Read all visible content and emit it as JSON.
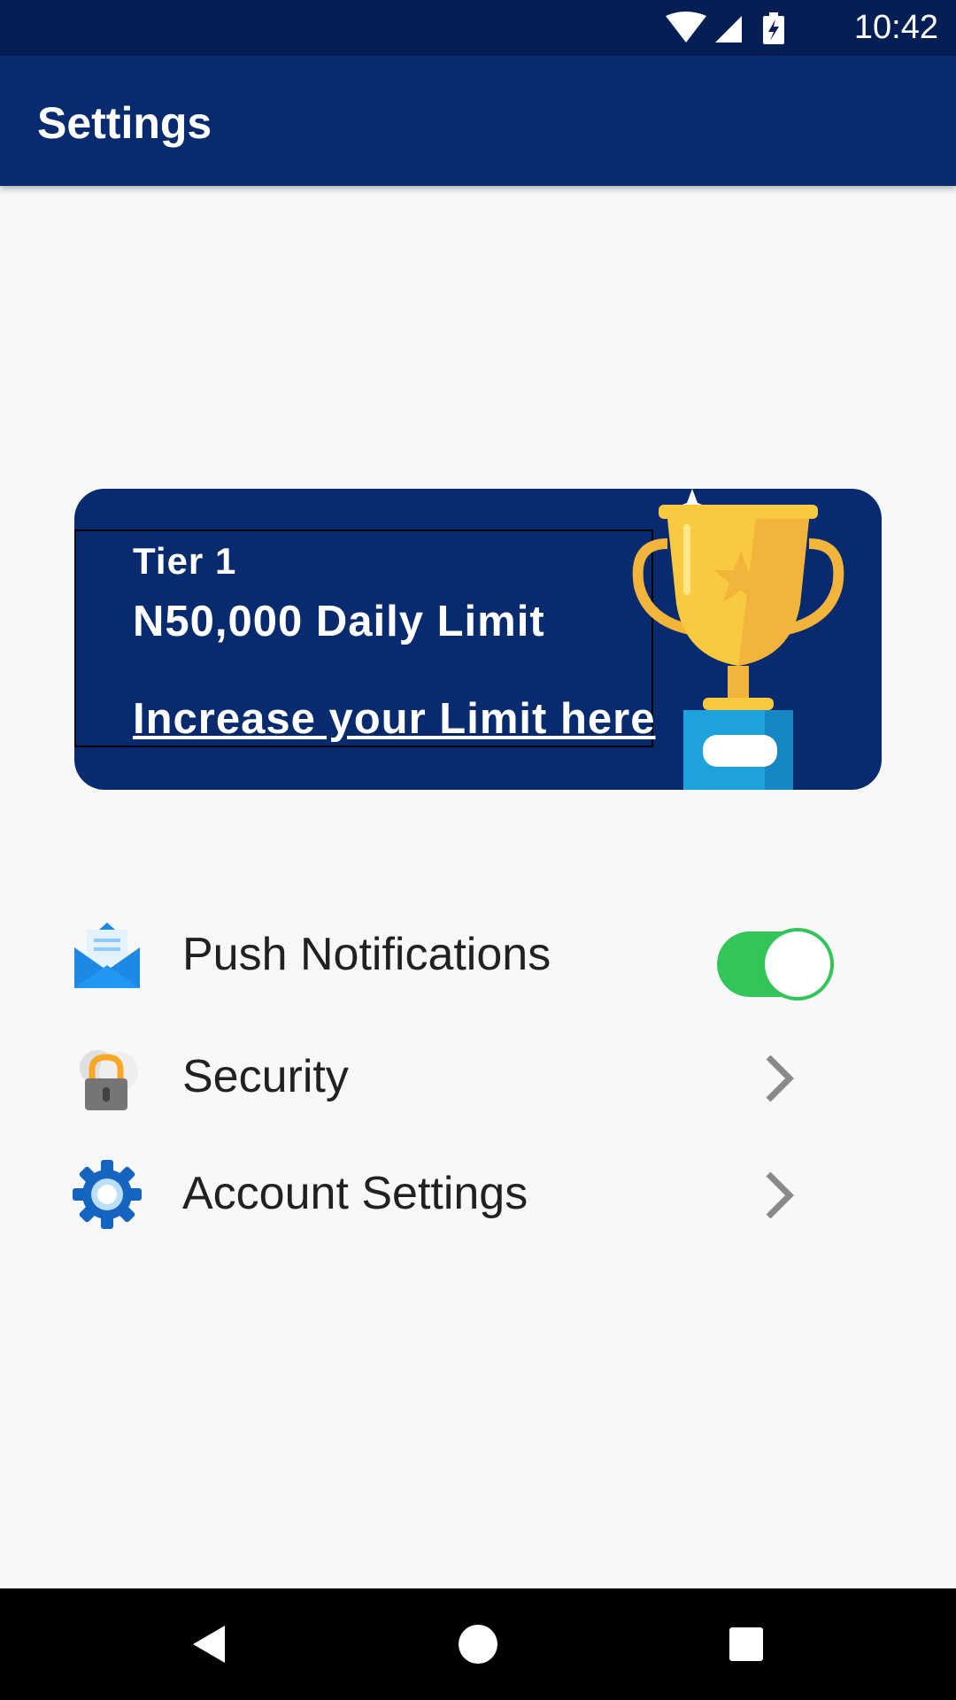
{
  "status_bar": {
    "time": "10:42",
    "icons": [
      "wifi-icon",
      "signal-icon",
      "battery-charging-icon"
    ]
  },
  "app_bar": {
    "title": "Settings"
  },
  "banner": {
    "tier": "Tier 1",
    "limit": "N50,000 Daily Limit",
    "link": "Increase your Limit here",
    "icon": "trophy-icon"
  },
  "settings": [
    {
      "label": "Push Notifications",
      "icon": "envelope-icon",
      "control": "toggle",
      "enabled": true
    },
    {
      "label": "Security",
      "icon": "lock-cloud-icon",
      "control": "chevron"
    },
    {
      "label": "Account Settings",
      "icon": "gear-icon",
      "control": "chevron"
    }
  ],
  "nav_bar": {
    "buttons": [
      "back-icon",
      "home-icon",
      "recents-icon"
    ]
  },
  "colors": {
    "primary": "#082a6e",
    "status_bar": "#051f55",
    "toggle_on": "#33c45a",
    "background": "#f8f8f8"
  }
}
